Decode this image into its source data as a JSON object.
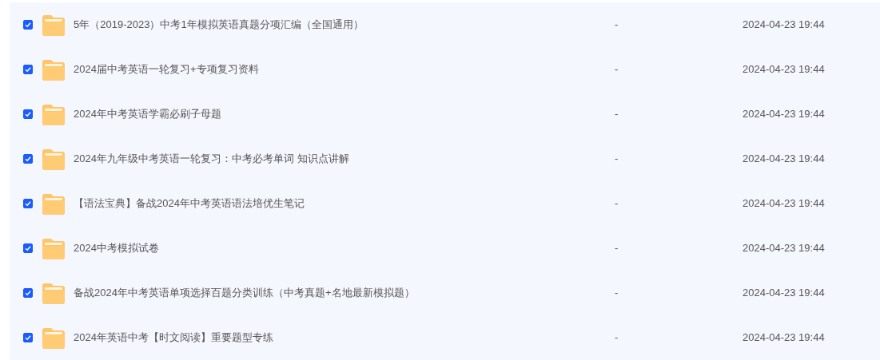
{
  "files": [
    {
      "name": "5年（2019-2023）中考1年模拟英语真题分项汇编（全国通用）",
      "size": "-",
      "modified": "2024-04-23 19:44",
      "checked": true
    },
    {
      "name": "2024届中考英语一轮复习+专项复习资料",
      "size": "-",
      "modified": "2024-04-23 19:44",
      "checked": true
    },
    {
      "name": "2024年中考英语学霸必刷子母题",
      "size": "-",
      "modified": "2024-04-23 19:44",
      "checked": true
    },
    {
      "name": "2024年九年级中考英语一轮复习：中考必考单词 知识点讲解",
      "size": "-",
      "modified": "2024-04-23 19:44",
      "checked": true
    },
    {
      "name": "【语法宝典】备战2024年中考英语语法培优生笔记",
      "size": "-",
      "modified": "2024-04-23 19:44",
      "checked": true
    },
    {
      "name": "2024中考模拟试卷",
      "size": "-",
      "modified": "2024-04-23 19:44",
      "checked": true
    },
    {
      "name": "备战2024年中考英语单项选择百题分类训练（中考真题+名地最新模拟题）",
      "size": "-",
      "modified": "2024-04-23 19:44",
      "checked": true
    },
    {
      "name": "2024年英语中考【时文阅读】重要题型专练",
      "size": "-",
      "modified": "2024-04-23 19:44",
      "checked": true
    }
  ]
}
